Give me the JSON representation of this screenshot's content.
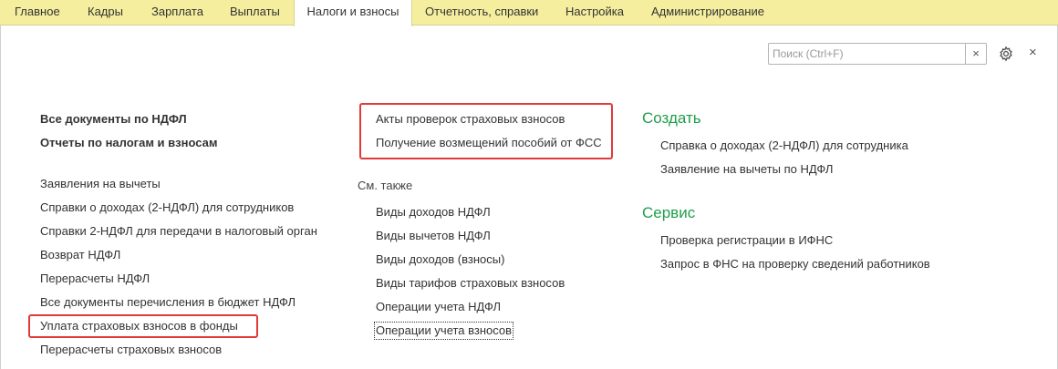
{
  "tabs": [
    {
      "label": "Главное"
    },
    {
      "label": "Кадры"
    },
    {
      "label": "Зарплата"
    },
    {
      "label": "Выплаты"
    },
    {
      "label": "Налоги и взносы",
      "active": true
    },
    {
      "label": "Отчетность, справки"
    },
    {
      "label": "Настройка"
    },
    {
      "label": "Администрирование"
    }
  ],
  "search": {
    "placeholder": "Поиск (Ctrl+F)",
    "value": "",
    "clear_glyph": "×"
  },
  "close_glyph": "×",
  "col1": {
    "bold_links": [
      "Все документы по НДФЛ",
      "Отчеты по налогам и взносам"
    ],
    "links": [
      "Заявления на вычеты",
      "Справки о доходах (2-НДФЛ) для сотрудников",
      "Справки 2-НДФЛ для передачи в налоговый орган",
      "Возврат НДФЛ",
      "Перерасчеты НДФЛ",
      "Все документы перечисления в бюджет НДФЛ",
      "Уплата страховых взносов в фонды",
      "Перерасчеты страховых взносов"
    ]
  },
  "col2": {
    "links": [
      "Акты проверок страховых взносов",
      "Получение возмещений пособий от ФСС"
    ],
    "see_also_label": "См. также",
    "see_also": [
      "Виды доходов НДФЛ",
      "Виды вычетов НДФЛ",
      "Виды доходов (взносы)",
      "Виды тарифов страховых взносов",
      "Операции учета НДФЛ",
      "Операции учета взносов"
    ]
  },
  "col3": {
    "create_title": "Создать",
    "create_links": [
      "Справка о доходах (2-НДФЛ) для сотрудника",
      "Заявление на вычеты по НДФЛ"
    ],
    "service_title": "Сервис",
    "service_links": [
      "Проверка регистрации в ИФНС",
      "Запрос в ФНС на проверку сведений работников"
    ]
  },
  "colors": {
    "tabbar_bg": "#f5ee9e",
    "section_title": "#1f9e4a",
    "highlight_border": "#e03a3a",
    "text": "#333333"
  }
}
